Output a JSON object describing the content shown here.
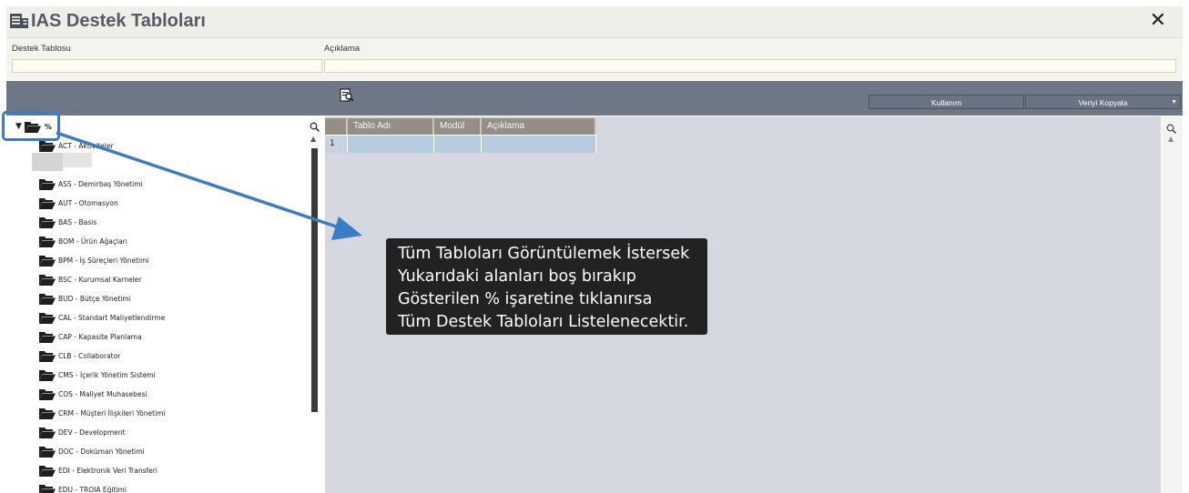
{
  "window": {
    "title": "IAS Destek Tabloları",
    "close_symbol": "✕"
  },
  "filters": {
    "destek_tablosu_label": "Destek Tablosu",
    "destek_tablosu_value": "",
    "aciklama_label": "Açıklama",
    "aciklama_value": ""
  },
  "toolbar": {
    "kullanim_label": "Kullanım",
    "veriyi_kopyala_label": "Veriyi Kopyala"
  },
  "tree": {
    "root_label": "%",
    "items": [
      "ACT - Aktiviteler",
      "ASS - Demirbaş Yönetimi",
      "AUT - Otomasyon",
      "BAS - Basis",
      "BOM - Ürün Ağaçları",
      "BPM - İş Süreçleri Yönetimi",
      "BSC - Kurumsal Karneler",
      "BUD - Bütçe Yönetimi",
      "CAL - Standart Maliyetlendirme",
      "CAP - Kapasite Planlama",
      "CLB - Collaborator",
      "CMS - İçerik Yönetim Sistemi",
      "COS - Maliyet Muhasebesi",
      "CRM - Müşteri İlişkileri Yönetimi",
      "DEV - Development",
      "DOC - Doküman Yönetimi",
      "EDI - Elektronik Veri Transferi",
      "EDU - TROIA Eğitimi"
    ]
  },
  "grid": {
    "columns": [
      "Tablo Adı",
      "Modül",
      "Açıklama"
    ],
    "rows": [
      {
        "num": "1",
        "tablo_adi": "",
        "modul": "",
        "aciklama": ""
      }
    ]
  },
  "callout": {
    "lines": [
      "Tüm Tabloları Görüntülemek İstersek",
      "Yukarıdaki alanları boş bırakıp",
      "Gösterilen % işaretine tıklanırsa",
      "Tüm Destek Tabloları Listelenecektir."
    ]
  },
  "colors": {
    "toolbar_bg": "#6e7785",
    "grid_header": "#958e84",
    "grid_row": "#b6cbe0",
    "panel_bg": "#d5d8e1",
    "annotation_blue": "#3b7cc4"
  }
}
